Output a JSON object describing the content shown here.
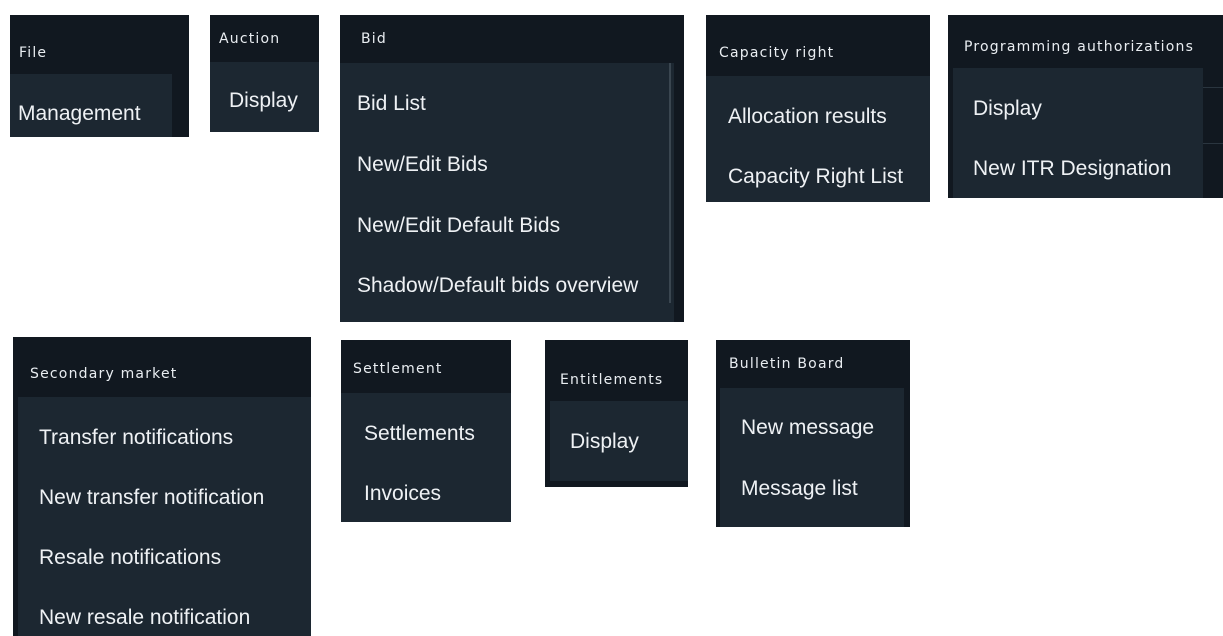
{
  "menus": {
    "file": {
      "title": "File",
      "items": [
        "Management"
      ]
    },
    "auction": {
      "title": "Auction",
      "items": [
        "Display"
      ]
    },
    "bid": {
      "title": "Bid",
      "items": [
        "Bid List",
        "New/Edit Bids",
        "New/Edit Default Bids",
        "Shadow/Default bids overview"
      ]
    },
    "capacity_right": {
      "title": "Capacity right",
      "items": [
        "Allocation results",
        "Capacity Right List"
      ]
    },
    "programming_authorizations": {
      "title": "Programming authorizations",
      "items": [
        "Display",
        "New ITR Designation"
      ]
    },
    "secondary_market": {
      "title": "Secondary market",
      "items": [
        "Transfer notifications",
        "New transfer notification",
        "Resale notifications",
        "New resale notification"
      ]
    },
    "settlement": {
      "title": "Settlement",
      "items": [
        "Settlements",
        "Invoices"
      ]
    },
    "entitlements": {
      "title": "Entitlements",
      "items": [
        "Display"
      ]
    },
    "bulletin_board": {
      "title": "Bulletin Board",
      "items": [
        "New message",
        "Message list"
      ]
    }
  },
  "colors": {
    "header_bg": "#111820",
    "panel_bg": "#1c2731",
    "text": "#eef1f4"
  }
}
